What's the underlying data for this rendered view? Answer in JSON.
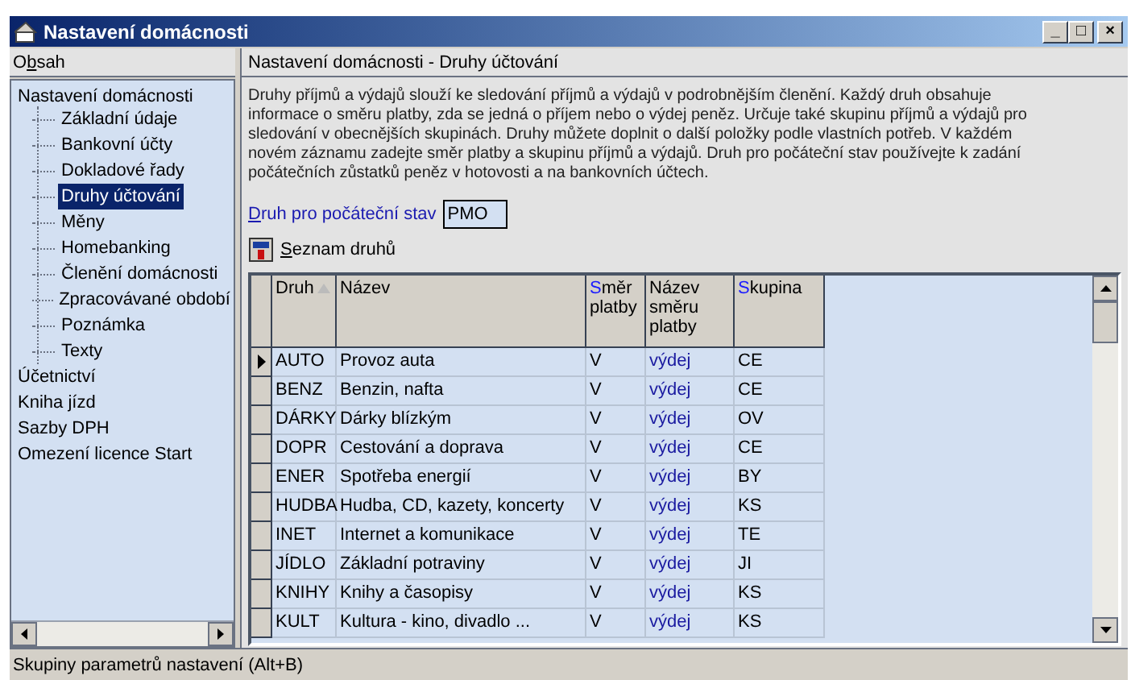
{
  "window": {
    "title": "Nastavení domácnosti",
    "controls": [
      "_",
      "□",
      "×"
    ]
  },
  "sidebar": {
    "header": {
      "before": "O",
      "accel": "b",
      "after": "sah"
    },
    "tree": [
      {
        "label": "Nastavení domácnosti",
        "expanded": true,
        "selected": false,
        "children": [
          {
            "label": "Základní údaje",
            "selected": false
          },
          {
            "label": "Bankovní účty",
            "selected": false
          },
          {
            "label": "Dokladové řady",
            "selected": false
          },
          {
            "label": "Druhy účtování",
            "selected": true
          },
          {
            "label": "Měny",
            "selected": false
          },
          {
            "label": "Homebanking",
            "selected": false
          },
          {
            "label": "Členění domácnosti",
            "selected": false
          },
          {
            "label": "Zpracovávané období",
            "selected": false
          },
          {
            "label": "Poznámka",
            "selected": false
          },
          {
            "label": "Texty",
            "selected": false
          }
        ]
      },
      {
        "label": "Účetnictví",
        "selected": false
      },
      {
        "label": "Kniha jízd",
        "selected": false
      },
      {
        "label": "Sazby DPH",
        "selected": false
      },
      {
        "label": "Omezení licence Start",
        "selected": false
      }
    ]
  },
  "content": {
    "title": "Nastavení domácnosti - Druhy účtování",
    "description": "Druhy příjmů a výdajů slouží ke sledování příjmů a výdajů v podrobnějším členění. Každý druh obsahuje informace o směru platby, zda se jedná o příjem nebo o výdej peněz. Určuje také skupinu příjmů a výdajů pro sledování v obecnějších skupinách. Druhy můžete doplnit o další položky podle vlastních potřeb. V každém novém záznamu zadejte směr platby a skupinu příjmů a výdajů. Druh pro počáteční stav používejte k zadání počátečních zůstatků peněz v hotovosti a na bankovních účtech.",
    "field": {
      "label": {
        "accel": "D",
        "after": "ruh pro počáteční stav"
      },
      "value": "PMO"
    },
    "toolbar_button": {
      "accel": "S",
      "after": "eznam druhů"
    },
    "table": {
      "columns": [
        {
          "rest": "Druh",
          "sorted": true
        },
        {
          "rest": "Název",
          "sorted": false
        },
        {
          "accent": "S",
          "rest": "měr platby",
          "sorted": false
        },
        {
          "rest": "Název směru platby",
          "sorted": false
        },
        {
          "accent": "S",
          "rest": "kupina",
          "sorted": false
        }
      ],
      "rows": [
        {
          "current": true,
          "cells": [
            "AUTO",
            "Provoz auta",
            "V",
            "výdej",
            "CE"
          ]
        },
        {
          "current": false,
          "cells": [
            "BENZ",
            "Benzin, nafta",
            "V",
            "výdej",
            "CE"
          ]
        },
        {
          "current": false,
          "cells": [
            "DÁRKY",
            "Dárky blízkým",
            "V",
            "výdej",
            "OV"
          ]
        },
        {
          "current": false,
          "cells": [
            "DOPR",
            "Cestování a doprava",
            "V",
            "výdej",
            "CE"
          ]
        },
        {
          "current": false,
          "cells": [
            "ENER",
            "Spotřeba energií",
            "V",
            "výdej",
            "BY"
          ]
        },
        {
          "current": false,
          "cells": [
            "HUDBA",
            "Hudba, CD, kazety, koncerty",
            "V",
            "výdej",
            "KS"
          ]
        },
        {
          "current": false,
          "cells": [
            "INET",
            "Internet a komunikace",
            "V",
            "výdej",
            "TE"
          ]
        },
        {
          "current": false,
          "cells": [
            "JÍDLO",
            "Základní potraviny",
            "V",
            "výdej",
            "JI"
          ]
        },
        {
          "current": false,
          "cells": [
            "KNIHY",
            "Knihy a časopisy",
            "V",
            "výdej",
            "KS"
          ]
        },
        {
          "current": false,
          "cells": [
            "KULT",
            "Kultura - kino, divadlo ...",
            "V",
            "výdej",
            "KS"
          ]
        }
      ]
    }
  },
  "status_bar": "Skupiny parametrů nastavení (Alt+B)"
}
